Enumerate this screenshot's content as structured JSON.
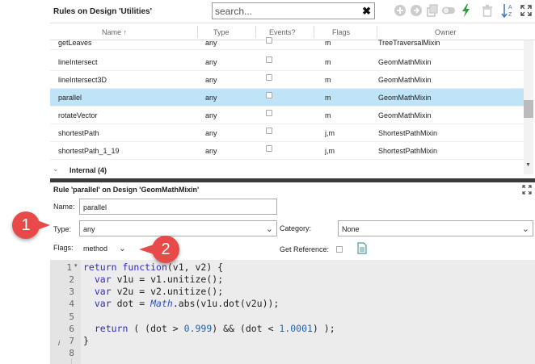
{
  "top_panel": {
    "title": "Rules on Design 'Utilities'",
    "search": {
      "value": "",
      "placeholder": "search...",
      "clear_symbol": "✖"
    },
    "toolbar": {
      "icons": [
        "add-icon",
        "add-link-icon",
        "copy-icon",
        "toggle-icon",
        "lightning-icon",
        "delete-icon",
        "sort-az-icon",
        "expand-icon"
      ]
    }
  },
  "grid": {
    "columns": [
      {
        "label": "Name ↑"
      },
      {
        "label": "Type"
      },
      {
        "label": "Events?"
      },
      {
        "label": "Flags"
      },
      {
        "label": "Owner"
      }
    ],
    "rows": [
      {
        "name": "getLeaves",
        "type": "any",
        "flags": "m",
        "owner": "TreeTraversalMixin",
        "selected": false
      },
      {
        "name": "lineIntersect",
        "type": "any",
        "flags": "m",
        "owner": "GeomMathMixin",
        "selected": false
      },
      {
        "name": "lineIntersect3D",
        "type": "any",
        "flags": "m",
        "owner": "GeomMathMixin",
        "selected": false
      },
      {
        "name": "parallel",
        "type": "any",
        "flags": "m",
        "owner": "GeomMathMixin",
        "selected": true
      },
      {
        "name": "rotateVector",
        "type": "any",
        "flags": "m",
        "owner": "GeomMathMixin",
        "selected": false
      },
      {
        "name": "shortestPath",
        "type": "any",
        "flags": "j,m",
        "owner": "ShortestPathMixin",
        "selected": false
      },
      {
        "name": "shortestPath_1_19",
        "type": "any",
        "flags": "j,m",
        "owner": "ShortestPathMixin",
        "selected": false
      }
    ],
    "group": {
      "label": "Internal (4)"
    }
  },
  "rule_panel": {
    "title": "Rule 'parallel' on Design 'GeomMathMixin'",
    "name_label": "Name:",
    "name_value": "parallel",
    "type_label": "Type:",
    "type_value": "any",
    "category_label": "Category:",
    "category_value": "None",
    "flags_label": "Flags:",
    "flags_value": "method",
    "get_reference_label": "Get Reference:"
  },
  "editor": {
    "line_numbers": [
      "1",
      "2",
      "3",
      "4",
      "5",
      "6",
      "7",
      "8"
    ]
  },
  "callouts": {
    "one": "1",
    "two": "2"
  },
  "colors": {
    "selected_row": "#bfe3f7",
    "callout": "#e84a4a",
    "accent_green": "#2e9e3e",
    "keyword": "#2f2ac4"
  }
}
